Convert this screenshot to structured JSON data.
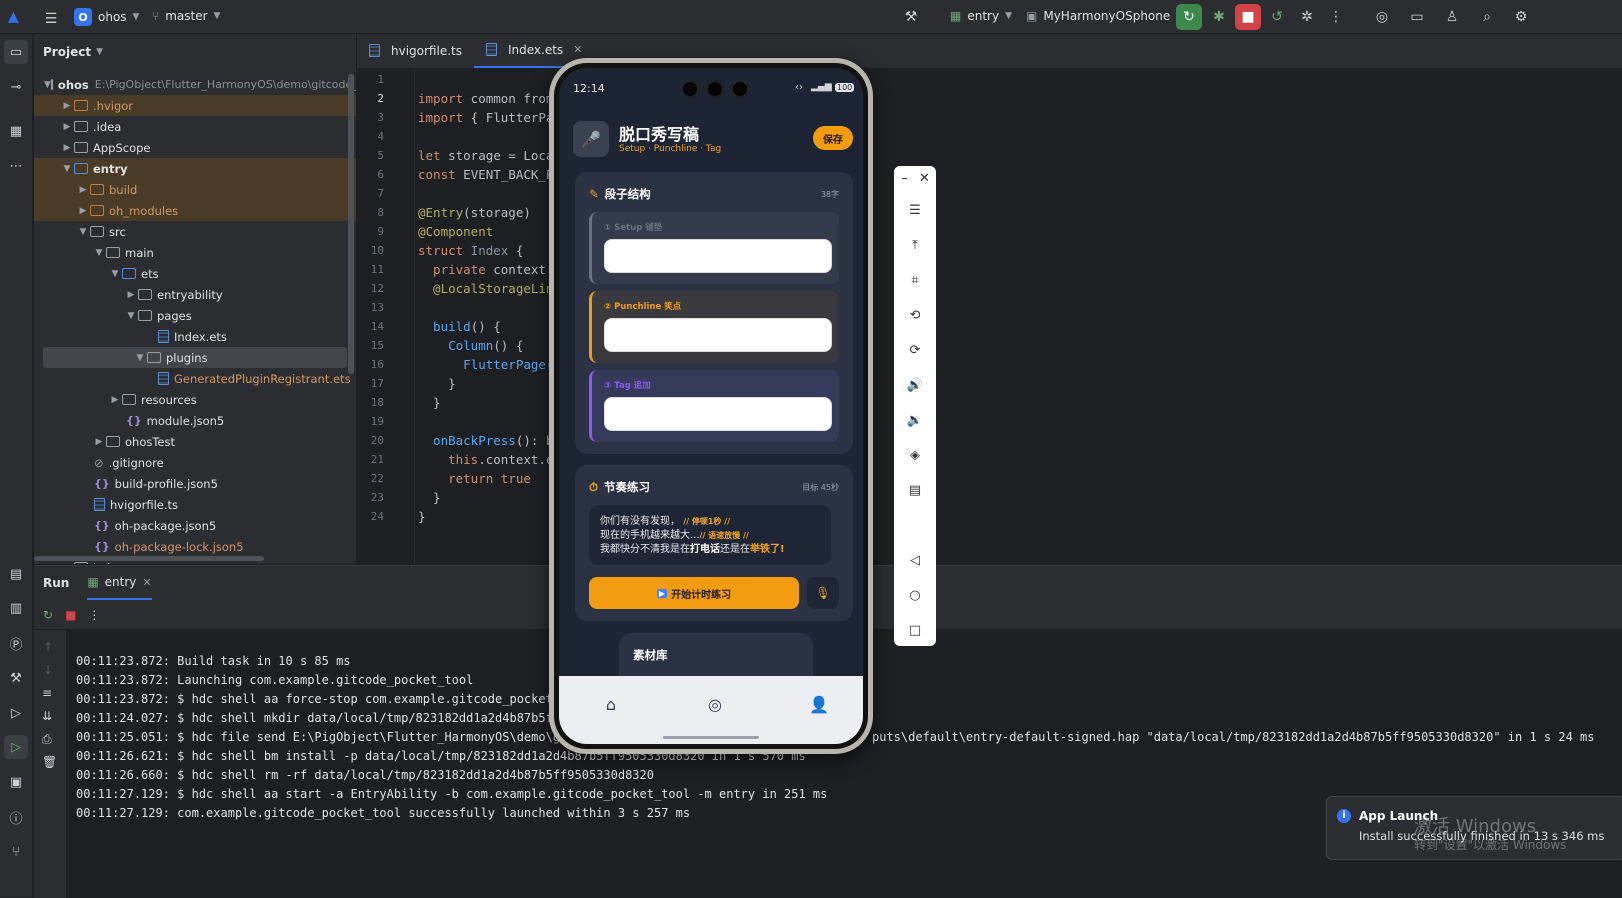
{
  "titlebar": {
    "project_badge": "O",
    "project_name": "ohos",
    "branch": "master",
    "run_config": "entry",
    "device": "MyHarmonyOSphone"
  },
  "project_panel": {
    "title": "Project",
    "root_name": "ohos",
    "root_path": "E:\\PigObject\\Flutter_HarmonyOS\\demo\\gitcode_p",
    "items": [
      {
        "label": ".hvigor"
      },
      {
        "label": ".idea"
      },
      {
        "label": "AppScope"
      },
      {
        "label": "entry"
      },
      {
        "label": "build"
      },
      {
        "label": "oh_modules"
      },
      {
        "label": "src"
      },
      {
        "label": "main"
      },
      {
        "label": "ets"
      },
      {
        "label": "entryability"
      },
      {
        "label": "pages"
      },
      {
        "label": "Index.ets"
      },
      {
        "label": "plugins"
      },
      {
        "label": "GeneratedPluginRegistrant.ets"
      },
      {
        "label": "resources"
      },
      {
        "label": "module.json5"
      },
      {
        "label": "ohosTest"
      },
      {
        "label": ".gitignore"
      },
      {
        "label": "build-profile.json5"
      },
      {
        "label": "hvigorfile.ts"
      },
      {
        "label": "oh-package.json5"
      },
      {
        "label": "oh-package-lock.json5"
      }
    ],
    "cut_item": "hvigor"
  },
  "editor": {
    "tabs": [
      {
        "label": "hvigorfile.ts"
      },
      {
        "label": "Index.ets"
      }
    ],
    "line_numbers": [
      "1",
      "2",
      "3",
      "4",
      "5",
      "6",
      "7",
      "8",
      "9",
      "10",
      "11",
      "12",
      "13",
      "14",
      "15",
      "16",
      "17",
      "18",
      "19",
      "20",
      "21",
      "22",
      "23",
      "24"
    ],
    "code": {
      "l2_kw": "import",
      "l2_rest": " common from",
      "l3_kw": "import",
      "l3_rest": " { FlutterPag",
      "l5_kw": "let",
      "l5_rest": " storage = Local",
      "l6_kw": "const",
      "l6_rest": " EVENT_BACK_PR",
      "l8_an": "@Entry",
      "l8_rest": "(storage)",
      "l9_an": "@Component",
      "l10_kw": "struct",
      "l10_cls": " Index",
      "l10_rest": " {",
      "l11_kw": "  private",
      "l11_rest": " context =",
      "l12_an": "  @LocalStorageLink",
      "l14_fn": "  build",
      "l14_rest": "() {",
      "l15_fn": "    Column",
      "l15_rest": "() {",
      "l16_fn": "      FlutterPage",
      "l16_rest": "({",
      "l17": "    }",
      "l18": "  }",
      "l20_fn": "  onBackPress",
      "l20_rest": "(): bo",
      "l21_kw": "    this",
      "l21_rest": ".context.ev",
      "l22_kw": "    return",
      "l22_kw2": " true",
      "l23": "  }",
      "l24": "}"
    }
  },
  "run_panel": {
    "title": "Run",
    "tab": "entry",
    "logs": [
      "00:11:23.872: Build task in 10 s 85 ms",
      "00:11:23.872: Launching com.example.gitcode_pocket_tool",
      "00:11:23.872: $ hdc shell aa force-stop com.example.gitcode_pocket_t",
      "00:11:24.027: $ hdc shell mkdir data/local/tmp/823182dd1a2d4b87b5ff95",
      "00:11:25.051: $ hdc file send E:\\PigObject\\Flutter_HarmonyOS\\demo\\git",
      "00:11:26.621: $ hdc shell bm install -p data/local/tmp/823182dd1a2d4b87b5ff9505330d8320 in 1 s 570 ms",
      "00:11:26.660: $ hdc shell rm -rf data/local/tmp/823182dd1a2d4b87b5ff9505330d8320",
      "00:11:27.129: $ hdc shell aa start -a EntryAbility -b com.example.gitcode_pocket_tool -m entry in 251 ms",
      "00:11:27.129: com.example.gitcode_pocket_tool successfully launched within 3 s 257 ms"
    ],
    "log5_tail": "puts\\default\\entry-default-signed.hap \"data/local/tmp/823182dd1a2d4b87b5ff9505330d8320\" in 1 s 24 ms"
  },
  "notification": {
    "title": "App Launch",
    "body": "Install successfully finished in 13 s 346 ms",
    "watermark1": "激活 Windows",
    "watermark2": "转到\"设置\"以激活 Windows"
  },
  "phone": {
    "time": "12:14",
    "battery": "100",
    "app_title": "脱口秀写稿",
    "app_subtitle": "Setup · Punchline · Tag",
    "save_label": "保存",
    "structure_card": {
      "title": "段子结构",
      "word_count": "38字",
      "segments": [
        {
          "label": "① Setup 铺垫",
          "color": "#6b7280"
        },
        {
          "label": "② Punchline 笑点",
          "color": "#f39c12"
        },
        {
          "label": "③ Tag 追加",
          "color": "#8b5cf6"
        }
      ]
    },
    "practice_card": {
      "title": "节奏练习",
      "goal": "目标 45秒",
      "line1_text": "你们有没有发现，",
      "line1_mark": "// 停顿1秒 //",
      "line2_text": "现在的手机越来越大...",
      "line2_mark": "// 语速放慢 //",
      "line3_a": "我都快分不清我是在",
      "line3_b": "打电话",
      "line3_c": "还是在",
      "line3_d": "举铁了!",
      "start_label": "开始计时练习"
    },
    "material_card": {
      "title": "素材库"
    }
  },
  "colors": {
    "accent": "#3574f0",
    "app_orange": "#f39c12",
    "app_purple": "#8b5cf6"
  }
}
